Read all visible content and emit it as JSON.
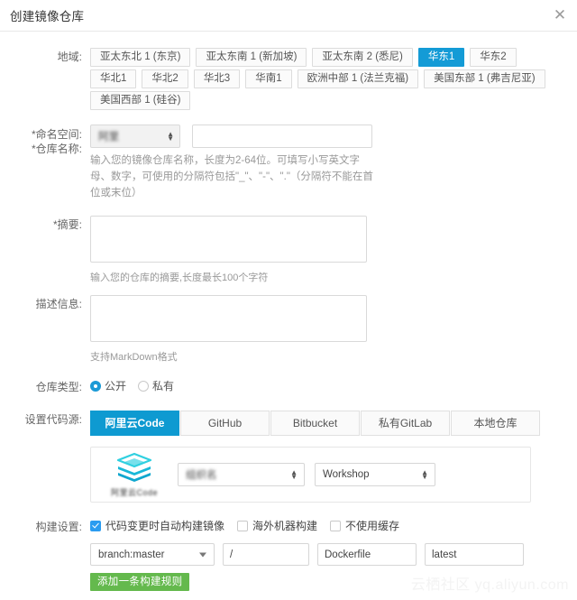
{
  "dialog": {
    "title": "创建镜像仓库",
    "close_icon": "close-icon"
  },
  "region": {
    "label": "地域:",
    "selected": "华东1",
    "options": [
      "亚太东北 1 (东京)",
      "亚太东南 1 (新加坡)",
      "亚太东南 2 (悉尼)",
      "华东1",
      "华东2",
      "华北1",
      "华北2",
      "华北3",
      "华南1",
      "欧洲中部 1 (法兰克福)",
      "美国东部 1 (弗吉尼亚)",
      "美国西部 1 (硅谷)"
    ]
  },
  "namespace": {
    "label_namespace": "*命名空间:",
    "label_repo_name": "*仓库名称:",
    "namespace_value": "阿里",
    "repo_name_value": "",
    "repo_name_placeholder": "",
    "hint": "输入您的镜像仓库名称，长度为2-64位。可填写小写英文字母、数字，可使用的分隔符包括\"_\"、\"-\"、\".\"（分隔符不能在首位或末位）"
  },
  "summary": {
    "label": "*摘要:",
    "value": "",
    "hint": "输入您的仓库的摘要,长度最长100个字符"
  },
  "description": {
    "label": "描述信息:",
    "value": "",
    "hint": "支持MarkDown格式"
  },
  "repo_type": {
    "label": "仓库类型:",
    "selected": "公开",
    "options": [
      "公开",
      "私有"
    ]
  },
  "code_source": {
    "label": "设置代码源:",
    "selected": "阿里云Code",
    "tabs": [
      "阿里云Code",
      "GitHub",
      "Bitbucket",
      "私有GitLab",
      "本地仓库"
    ],
    "panel": {
      "logo_icon": "stacked-layers-icon",
      "logo_label": "阿里云Code",
      "org_value": "组织名",
      "project_value": "Workshop"
    }
  },
  "build_settings": {
    "label": "构建设置:",
    "checkboxes": [
      {
        "label": "代码变更时自动构建镜像",
        "checked": true
      },
      {
        "label": "海外机器构建",
        "checked": false
      },
      {
        "label": "不使用缓存",
        "checked": false
      }
    ],
    "rule": {
      "branch": "branch:master",
      "path": "/",
      "dockerfile": "Dockerfile",
      "tag": "latest"
    },
    "add_rule_label": "添加一条构建规则"
  },
  "watermark": "云栖社区 yq.aliyun.com",
  "colors": {
    "accent_blue": "#149bd6",
    "tab_blue": "#0e9ad1",
    "checkbox_blue": "#2b9cf0",
    "add_button_green": "#64b94d",
    "logo_cyan": "#28c8e0"
  }
}
